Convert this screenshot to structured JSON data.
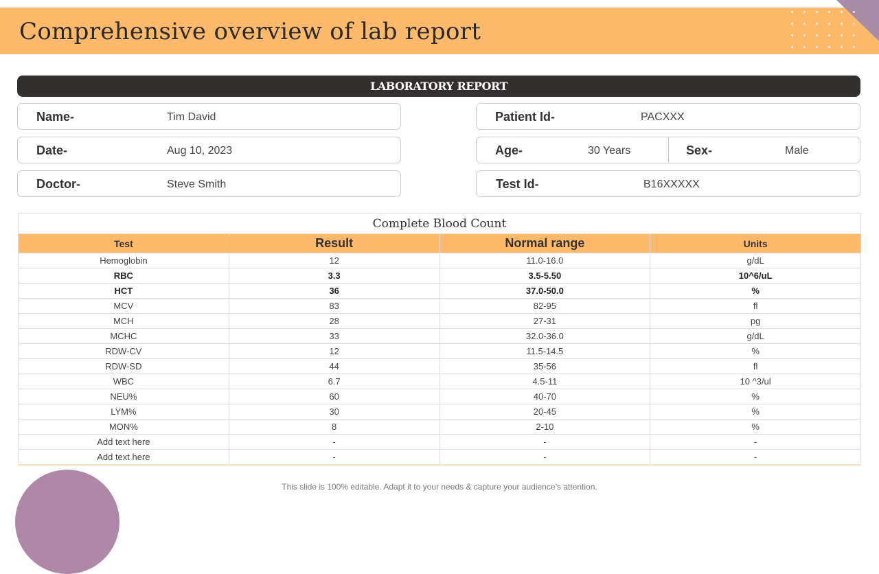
{
  "header": {
    "title": "Comprehensive overview of lab report"
  },
  "report": {
    "banner": "LABORATORY REPORT",
    "name_label": "Name-",
    "name": "Tim David",
    "date_label": "Date-",
    "date": "Aug 10, 2023",
    "doctor_label": "Doctor-",
    "doctor": "Steve Smith",
    "patient_id_label": "Patient Id-",
    "patient_id": "PACXXX",
    "age_label": "Age-",
    "age": "30 Years",
    "sex_label": "Sex-",
    "sex": "Male",
    "test_id_label": "Test Id-",
    "test_id": "B16XXXXX"
  },
  "table": {
    "caption": "Complete Blood Count",
    "headers": [
      "Test",
      "Result",
      "Normal range",
      "Units"
    ],
    "rows": [
      [
        "Hemoglobin",
        "12",
        "11.0-16.0",
        "g/dL"
      ],
      [
        "RBC",
        "3.3",
        "3.5-5.50",
        "10^6/uL"
      ],
      [
        "HCT",
        "36",
        "37.0-50.0",
        "%"
      ],
      [
        "MCV",
        "83",
        "82-95",
        "fl"
      ],
      [
        "MCH",
        "28",
        "27-31",
        "pg"
      ],
      [
        "MCHC",
        "33",
        "32.0-36.0",
        "g/dL"
      ],
      [
        "RDW-CV",
        "12",
        "11.5-14.5",
        "%"
      ],
      [
        "RDW-SD",
        "44",
        "35-56",
        "fl"
      ],
      [
        "WBC",
        "6.7",
        "4.5-11",
        "10 ^3/ul"
      ],
      [
        "NEU%",
        "60",
        "40-70",
        "%"
      ],
      [
        "LYM%",
        "30",
        "20-45",
        "%"
      ],
      [
        "MON%",
        "8",
        "2-10",
        "%"
      ],
      [
        "Add text here",
        "-",
        "-",
        "-"
      ],
      [
        "Add text here",
        "-",
        "-",
        "-"
      ]
    ],
    "bold_rows": [
      1,
      2
    ]
  },
  "footer": "This slide is 100% editable. Adapt it to your needs & capture your audience’s attention."
}
